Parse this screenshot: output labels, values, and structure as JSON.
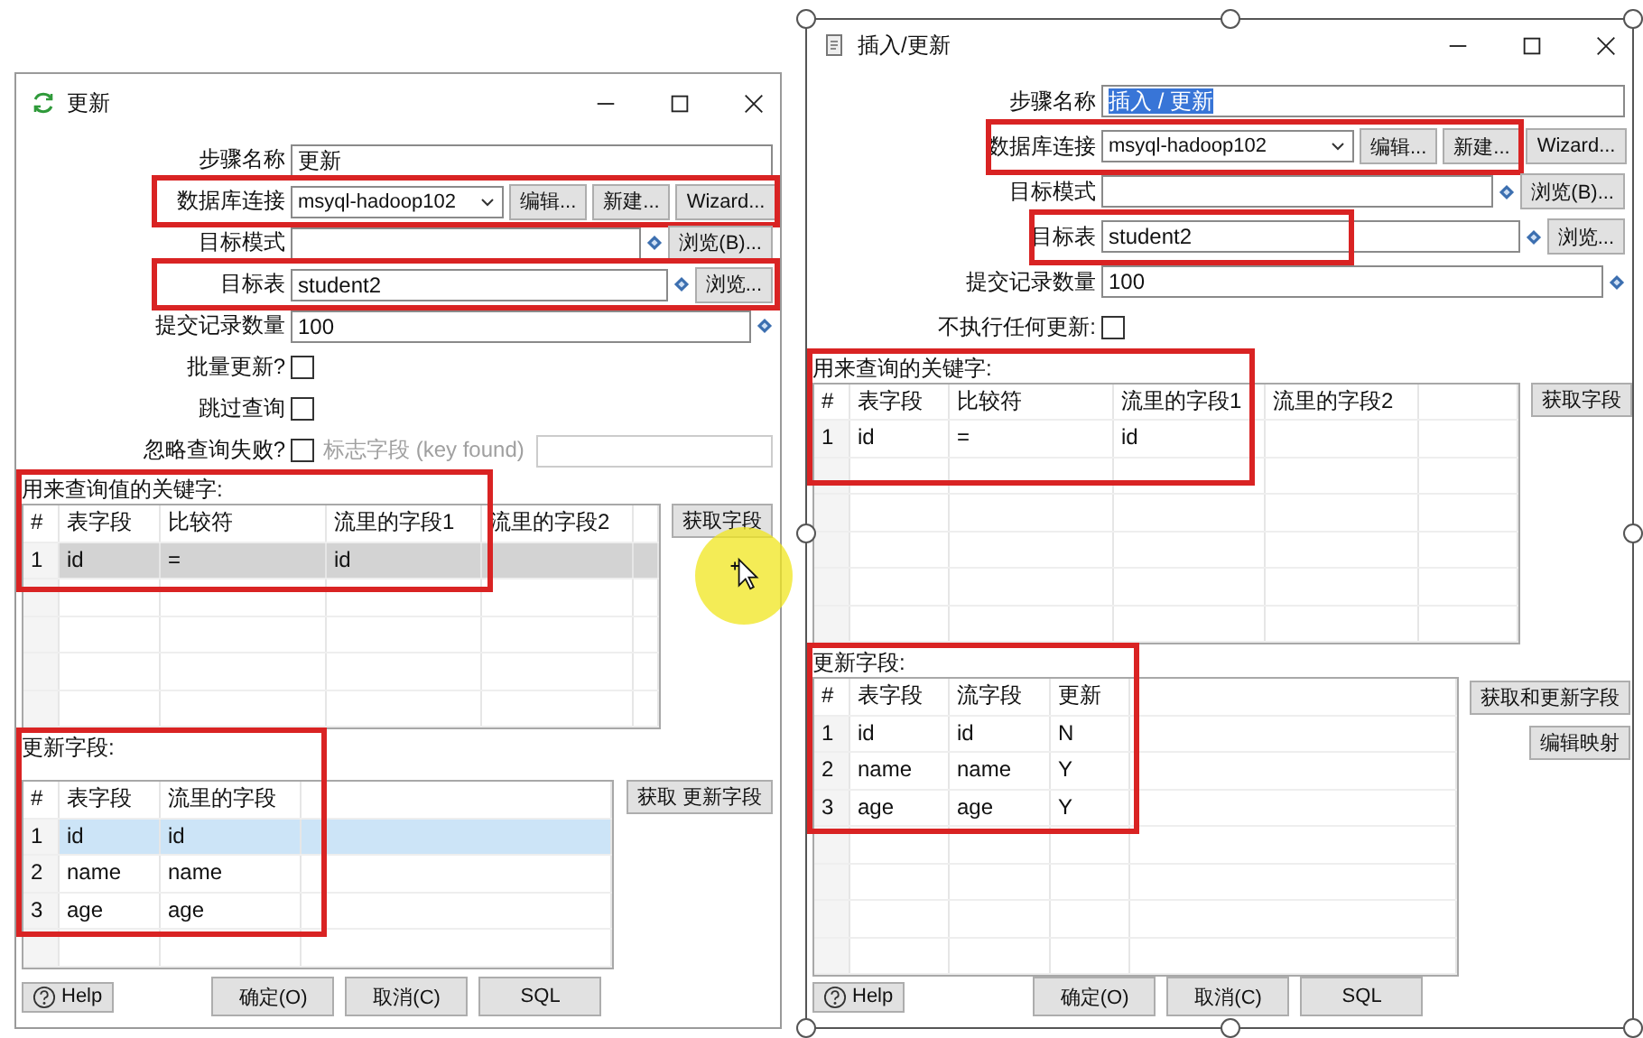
{
  "windows": [
    {
      "title": "更新",
      "selected_frame": false,
      "fields": [
        {
          "kind": "text",
          "label": "步骤名称",
          "value": "更新",
          "value_selected": false,
          "highlighted": false
        },
        {
          "kind": "select",
          "label": "数据库连接",
          "value": "msyql-hadoop102",
          "buttons": [
            "编辑...",
            "新建...",
            "Wizard..."
          ],
          "highlighted": true
        },
        {
          "kind": "browse",
          "label": "目标模式",
          "button": "浏览(B)...",
          "highlighted": false
        },
        {
          "kind": "browse",
          "label": "目标表",
          "value": "student2",
          "button": "浏览...",
          "highlighted": true
        },
        {
          "kind": "variable",
          "label": "提交记录数量",
          "value": "100",
          "highlighted": false
        },
        {
          "kind": "checkbox",
          "label": "批量更新?",
          "checked": false,
          "highlighted": false
        },
        {
          "kind": "checkbox",
          "label": "跳过查询",
          "checked": false,
          "highlighted": false
        },
        {
          "kind": "checkbox_flag",
          "label": "忽略查询失败?",
          "checked": false,
          "flag_label": "标志字段 (key found)",
          "highlighted": false
        }
      ],
      "tables": [
        {
          "label": "用来查询值的关键字:",
          "highlighted": true,
          "columns": [
            "#",
            "表字段",
            "比较符",
            "流里的字段1",
            "流里的字段2"
          ],
          "rows": [
            {
              "cells": [
                "1",
                "id",
                "=",
                "id",
                ""
              ],
              "selected": true
            }
          ],
          "buttons": [
            "获取字段"
          ]
        },
        {
          "label": "更新字段:",
          "highlighted": true,
          "columns": [
            "#",
            "表字段",
            "流里的字段"
          ],
          "rows": [
            {
              "cells": [
                "1",
                "id",
                "id"
              ],
              "selected": true
            },
            {
              "cells": [
                "2",
                "name",
                "name"
              ],
              "selected": false
            },
            {
              "cells": [
                "3",
                "age",
                "age"
              ],
              "selected": false
            }
          ],
          "buttons": [
            "获取 更新字段"
          ]
        }
      ],
      "help": "Help",
      "footer_buttons": [
        "确定(O)",
        "取消(C)",
        "SQL"
      ]
    },
    {
      "title": "插入/更新",
      "selected_frame": true,
      "fields": [
        {
          "kind": "text",
          "label": "步骤名称",
          "value": "插入 / 更新",
          "value_selected": true,
          "highlighted": false
        },
        {
          "kind": "select",
          "label": "数据库连接",
          "value": "msyql-hadoop102",
          "buttons": [
            "编辑...",
            "新建...",
            "Wizard..."
          ],
          "highlighted": true
        },
        {
          "kind": "browse",
          "label": "目标模式",
          "button": "浏览(B)...",
          "highlighted": false
        },
        {
          "kind": "browse",
          "label": "目标表",
          "value": "student2",
          "button": "浏览...",
          "highlighted": true
        },
        {
          "kind": "variable",
          "label": "提交记录数量",
          "value": "100",
          "highlighted": false
        },
        {
          "kind": "checkbox",
          "label": "不执行任何更新:",
          "checked": false,
          "highlighted": false
        }
      ],
      "tables": [
        {
          "label": "用来查询的关键字:",
          "highlighted": true,
          "columns": [
            "#",
            "表字段",
            "比较符",
            "流里的字段1",
            "流里的字段2"
          ],
          "rows": [
            {
              "cells": [
                "1",
                "id",
                "=",
                "id",
                ""
              ],
              "selected": false
            }
          ],
          "buttons": [
            "获取字段"
          ]
        },
        {
          "label": "更新字段:",
          "highlighted": true,
          "columns": [
            "#",
            "表字段",
            "流字段",
            "更新"
          ],
          "rows": [
            {
              "cells": [
                "1",
                "id",
                "id",
                "N"
              ],
              "selected": false
            },
            {
              "cells": [
                "2",
                "name",
                "name",
                "Y"
              ],
              "selected": false
            },
            {
              "cells": [
                "3",
                "age",
                "age",
                "Y"
              ],
              "selected": false
            }
          ],
          "buttons": [
            "获取和更新字段",
            "编辑映射"
          ]
        }
      ],
      "help": "Help",
      "footer_buttons": [
        "确定(O)",
        "取消(C)",
        "SQL"
      ]
    }
  ]
}
